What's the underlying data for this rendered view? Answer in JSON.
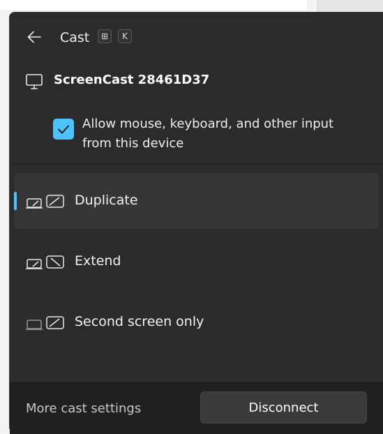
{
  "header": {
    "title": "Cast",
    "shortcut_keys": [
      "⊞",
      "K"
    ]
  },
  "device": {
    "name": "ScreenCast 28461D37",
    "allow_input_label": "Allow mouse, keyboard, and other input from this device",
    "allow_input_checked": true
  },
  "modes": [
    {
      "label": "Duplicate",
      "icon": "duplicate-icon",
      "selected": true
    },
    {
      "label": "Extend",
      "icon": "extend-icon",
      "selected": false
    },
    {
      "label": "Second screen only",
      "icon": "second-screen-only-icon",
      "selected": false
    }
  ],
  "footer": {
    "more_settings_label": "More cast settings",
    "disconnect_label": "Disconnect"
  },
  "colors": {
    "accent": "#4cc2ff",
    "panel_bg": "#2b2b2b",
    "footer_bg": "#202020"
  }
}
